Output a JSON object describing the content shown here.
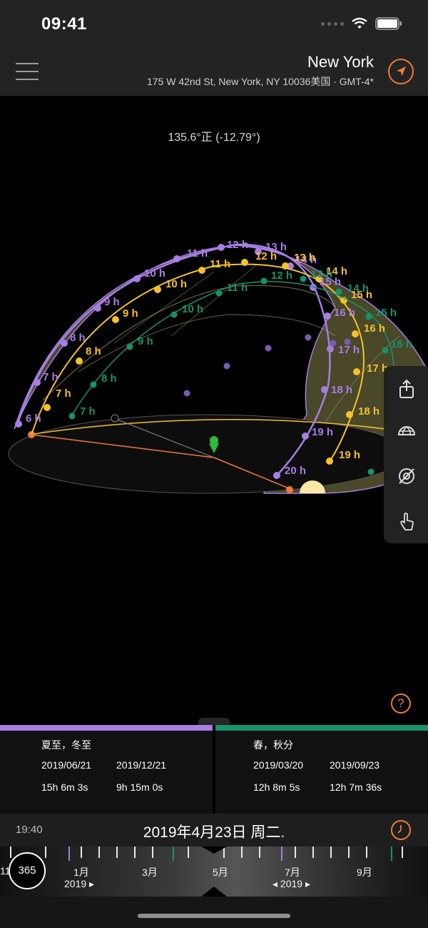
{
  "status_bar": {
    "time": "09:41"
  },
  "header": {
    "city": "New York",
    "address": "175 W 42nd St, New York, NY 10036美国 · GMT-4*"
  },
  "view": {
    "angle_readout": "135.6°正 (-12.79°)",
    "summer_path_labels": [
      "6 h",
      "7 h",
      "8 h",
      "9 h",
      "10 h",
      "11 h",
      "12 h",
      "13 h",
      "14 h",
      "15 h",
      "16 h",
      "17 h",
      "18 h",
      "19 h",
      "20 h"
    ],
    "today_path_labels": [
      "7 h",
      "8 h",
      "9 h",
      "10 h",
      "11 h",
      "12 h",
      "13 h",
      "14 h",
      "15 h",
      "16 h",
      "17 h",
      "18 h",
      "19 h"
    ],
    "winter_path_labels": [
      "7 h",
      "8 h",
      "9 h",
      "10 h",
      "11 h",
      "12 h",
      "13 h",
      "14 h",
      "15 h",
      "16 h"
    ],
    "colors": {
      "summer": "#a77ee3",
      "today": "#f5c02c",
      "equinox": "#16926d",
      "accent": "#f07a3a"
    }
  },
  "toolbar": {
    "icons": [
      "share-icon",
      "globe-icon",
      "no-sun-icon",
      "hand-pointer-icon"
    ]
  },
  "solstice": {
    "title": "夏至，冬至",
    "date1": "2019/06/21",
    "date2": "2019/12/21",
    "len1": "15h 6m 3s",
    "len2": "9h 15m 0s"
  },
  "equinox": {
    "title": "春，秋分",
    "date1": "2019/03/20",
    "date2": "2019/09/23",
    "len1": "12h 8m 5s",
    "len2": "12h 7m 36s"
  },
  "date_bar": {
    "time": "19:40",
    "date": "2019年4月23日 周二."
  },
  "timeline": {
    "badge": "365",
    "left_edge": "11",
    "months": [
      "1月",
      "3月",
      "5月",
      "7月",
      "9月"
    ],
    "year_left": "2019 ▸",
    "year_right": "◂ 2019 ▸"
  }
}
